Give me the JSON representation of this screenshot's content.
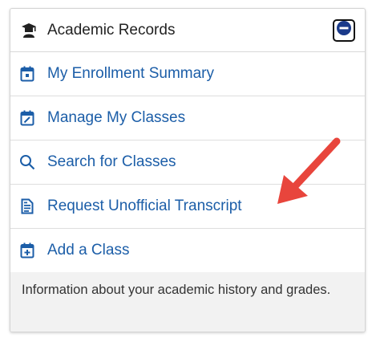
{
  "header": {
    "title": "Academic Records",
    "icon": "graduate-icon",
    "collapse_icon": "minus-circle-icon"
  },
  "items": [
    {
      "label": "My Enrollment Summary",
      "icon": "calendar-day-icon"
    },
    {
      "label": "Manage My Classes",
      "icon": "calendar-edit-icon"
    },
    {
      "label": "Search for Classes",
      "icon": "search-icon"
    },
    {
      "label": "Request Unofficial Transcript",
      "icon": "document-icon"
    },
    {
      "label": "Add a Class",
      "icon": "calendar-plus-icon"
    }
  ],
  "footer": {
    "text": "Information about your academic history and grades."
  },
  "colors": {
    "link": "#1c5ea8",
    "arrow": "#e8453c"
  }
}
